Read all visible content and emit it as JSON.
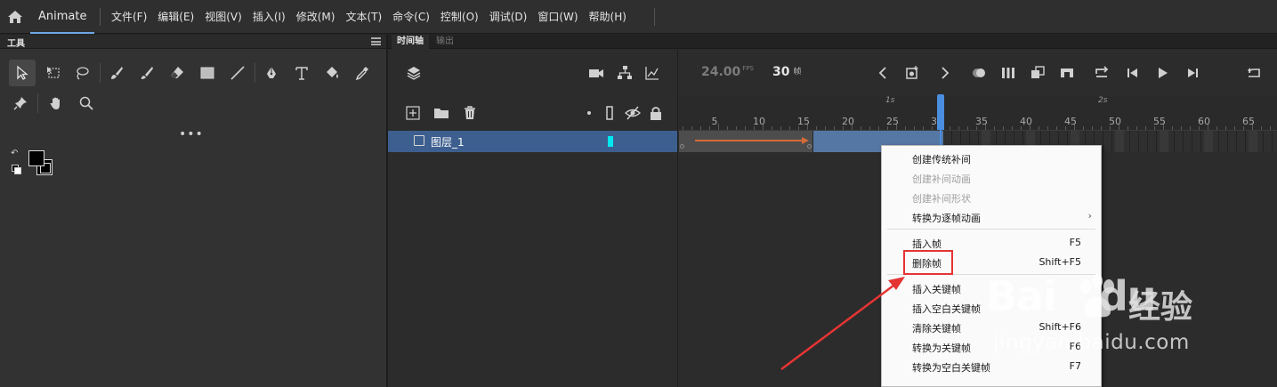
{
  "app": {
    "name": "Animate",
    "menu": [
      "文件(F)",
      "编辑(E)",
      "视图(V)",
      "插入(I)",
      "修改(M)",
      "文本(T)",
      "命令(C)",
      "控制(O)",
      "调试(D)",
      "窗口(W)",
      "帮助(H)"
    ]
  },
  "tools_panel": {
    "title": "工具",
    "more": "•••",
    "tools": [
      "selection-tool",
      "free-transform-tool",
      "lasso-tool",
      "paint-brush-tool",
      "brush-tool",
      "eraser-tool",
      "rectangle-tool",
      "line-tool",
      "pen-tool",
      "text-tool",
      "paint-bucket-tool",
      "eyedropper-tool",
      "pin-tool",
      "hand-tool",
      "zoom-tool"
    ],
    "stroke_color": "#000000",
    "fill_color": "#000000"
  },
  "timeline": {
    "tab_active": "时间轴",
    "tab_inactive": "输出",
    "fps_value": "24.00",
    "fps_unit": "FPS",
    "current_frame": "30",
    "frame_unit": "帧",
    "seconds": [
      "1s",
      "2s"
    ],
    "frame_ticks": [
      "5",
      "10",
      "15",
      "20",
      "25",
      "30",
      "35",
      "40",
      "45",
      "50",
      "55",
      "60",
      "65"
    ],
    "layer": {
      "name": "图层_1",
      "color": "#00e8f0"
    },
    "selection_color": "#3d5f8f",
    "playhead_color": "#4a8ee0"
  },
  "context_menu": {
    "items": [
      {
        "label": "创建传统补间",
        "shortcut": "",
        "disabled": false
      },
      {
        "label": "创建补间动画",
        "shortcut": "",
        "disabled": true
      },
      {
        "label": "创建补间形状",
        "shortcut": "",
        "disabled": true
      },
      {
        "label": "转换为逐帧动画",
        "shortcut": "›",
        "disabled": false
      },
      {
        "label": "插入帧",
        "shortcut": "F5",
        "disabled": false
      },
      {
        "label": "删除帧",
        "shortcut": "Shift+F5",
        "disabled": false
      },
      {
        "label": "插入关键帧",
        "shortcut": "",
        "disabled": false
      },
      {
        "label": "插入空白关键帧",
        "shortcut": "",
        "disabled": false
      },
      {
        "label": "清除关键帧",
        "shortcut": "Shift+F6",
        "disabled": false
      },
      {
        "label": "转换为关键帧",
        "shortcut": "F6",
        "disabled": false
      },
      {
        "label": "转换为空白关键帧",
        "shortcut": "F7",
        "disabled": false
      }
    ]
  },
  "annotation": {
    "highlight_color": "#e53434"
  },
  "watermark": {
    "brand": "Bai",
    "brand2": "du",
    "cn": "经验",
    "url": "jingyan.baidu.com"
  }
}
